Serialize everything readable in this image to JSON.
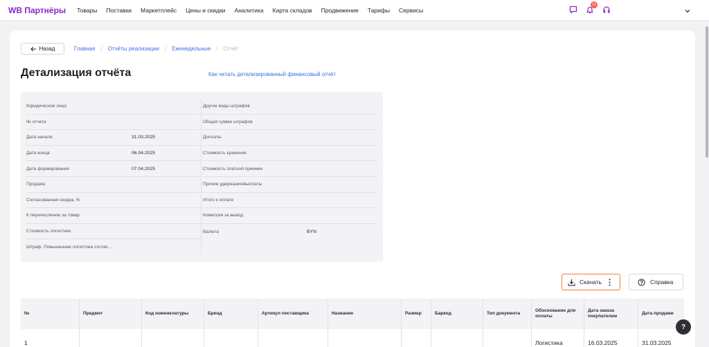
{
  "app": {
    "logo": "WB Партнёры"
  },
  "nav": [
    "Товары",
    "Поставки",
    "Маркетплейс",
    "Цены и скидки",
    "Аналитика",
    "Карта складов",
    "Продвижение",
    "Тарифы",
    "Сервисы"
  ],
  "notifications": {
    "count": "12"
  },
  "breadcrumb": {
    "back_label": "Назад",
    "items": [
      "Главная",
      "Отчёты реализации",
      "Еженедельные"
    ],
    "current": "Отчёт"
  },
  "page": {
    "title": "Детализация отчёта",
    "help_link": "Как читать детализированный финансовый отчёт"
  },
  "info": {
    "left": [
      {
        "label": "Юридическое лицо",
        "value": ""
      },
      {
        "label": "№ отчета",
        "value": ""
      },
      {
        "label": "Дата начала",
        "value": "31.03.2025"
      },
      {
        "label": "Дата конца",
        "value": "06.04.2025"
      },
      {
        "label": "Дата формирования",
        "value": "07.04.2025"
      },
      {
        "label": "Продажа",
        "value": ""
      },
      {
        "label": "Согласованная скидка, %",
        "value": ""
      },
      {
        "label": "К перечислению за товар",
        "value": ""
      },
      {
        "label": "Стоимость логистики",
        "value": ""
      },
      {
        "label": "Штраф. Повышенная логистика согласно коэффициенту по обмерам",
        "display": "Штраф. Повышенная логистика соглас…",
        "value": ""
      }
    ],
    "right": [
      {
        "label": "Другие виды штрафов",
        "value": ""
      },
      {
        "label": "Общая сумма штрафов",
        "value": ""
      },
      {
        "label": "Доплаты",
        "value": ""
      },
      {
        "label": "Стоимость хранения",
        "value": ""
      },
      {
        "label": "Стоимость платной приемки",
        "value": ""
      },
      {
        "label": "Прочие удержания/выплаты",
        "value": ""
      },
      {
        "label": "Итого к оплате",
        "value": ""
      },
      {
        "label": "Комиссия за вывод",
        "value": ""
      },
      {
        "label": "Валюта",
        "value": "BYN"
      }
    ]
  },
  "actions": {
    "download_label": "Скачать",
    "help_label": "Справка"
  },
  "table": {
    "columns": [
      "№",
      "Предмет",
      "Код номенклатуры",
      "Бренд",
      "Артикул поставщика",
      "Название",
      "Размер",
      "Баркод",
      "Тип документа",
      "Обоснование для оплаты",
      "Дата заказа покупателем",
      "Дата продажи"
    ],
    "rows": [
      [
        "1",
        "",
        "",
        "",
        "",
        "",
        "",
        "",
        "",
        "Логистика",
        "16.03.2025",
        "31.03.2025"
      ]
    ]
  },
  "colors": {
    "brand": "#8b26c9",
    "link": "#3b6fe0",
    "highlight": "#ef7d3a"
  },
  "icons": [
    "chat-icon",
    "bell-icon",
    "headset-icon",
    "chevron-down-icon",
    "arrow-left-icon",
    "download-icon",
    "kebab-icon",
    "question-circle-icon"
  ]
}
